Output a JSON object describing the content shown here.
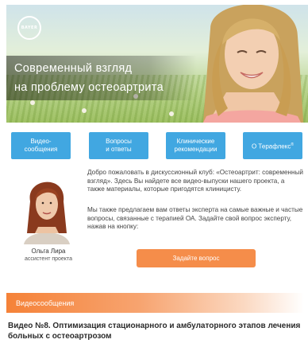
{
  "banner": {
    "logo_text": "BAYER",
    "title_line1": "Современный взгляд",
    "title_line2": "на проблему  остеоартрита"
  },
  "nav": {
    "items": [
      {
        "label": "Видео-\nсообщения"
      },
      {
        "label": "Вопросы\nи ответы"
      },
      {
        "label": "Клинические\nрекомендации"
      },
      {
        "label": "О Терафлекс",
        "sup": "®"
      }
    ]
  },
  "assistant": {
    "name": "Ольга Лира",
    "role": "ассистент проекта"
  },
  "intro": {
    "paragraph1": "Добро пожаловать в дискуссионный клуб: «Остеоартрит: современный взгляд». Здесь Вы найдете все видео-выпуски нашего проекта, а также материалы, которые пригодятся клиницисту.",
    "paragraph2": "Мы также предлагаем вам ответы эксперта на самые важные и частые вопросы, связанные с терапией ОА. Задайте свой вопрос эксперту, нажав на кнопку:",
    "ask_button": "Задайте вопрос"
  },
  "section": {
    "title": "Видеосообщения"
  },
  "video": {
    "title": "Видео №8. Оптимизация стационарного и амбулаторного этапов лечения больных с остеоартрозом"
  },
  "colors": {
    "nav_blue": "#41a7e1",
    "accent_orange": "#f58d4a",
    "section_orange": "#f58238"
  }
}
